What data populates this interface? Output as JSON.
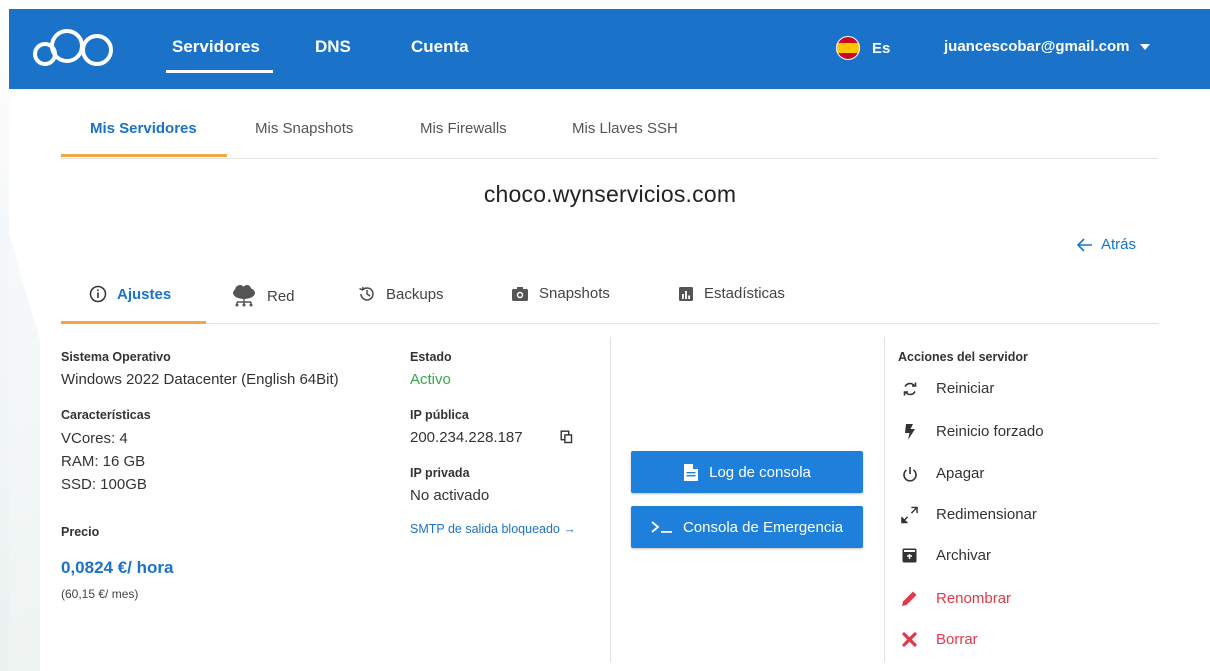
{
  "brand": {
    "logo_icon": "cloud-circles-logo",
    "accent": "#1a73c9",
    "highlight": "#f5a640"
  },
  "topnav": {
    "items": [
      "Servidores",
      "DNS",
      "Cuenta"
    ],
    "active": "Servidores",
    "language": "Es",
    "user_email": "juancescobar@gmail.com"
  },
  "subtabs": {
    "items": [
      "Mis Servidores",
      "Mis Snapshots",
      "Mis Firewalls",
      "Mis Llaves SSH"
    ],
    "active": "Mis Servidores"
  },
  "server": {
    "hostname": "choco.wynservicios.com",
    "back_label": "Atrás"
  },
  "detail_tabs": {
    "items": [
      "Ajustes",
      "Red",
      "Backups",
      "Snapshots",
      "Estadísticas"
    ],
    "active": "Ajustes"
  },
  "settings": {
    "os_label": "Sistema Operativo",
    "os_value": "Windows 2022 Datacenter (English 64Bit)",
    "features_label": "Características",
    "vcores": "VCores: 4",
    "ram": "RAM: 16 GB",
    "ssd": "SSD: 100GB",
    "price_label": "Precio",
    "price_hour": "0,0824 €/ hora",
    "price_month": "(60,15 €/ mes)",
    "state_label": "Estado",
    "state_value": "Activo",
    "public_ip_label": "IP pública",
    "public_ip_value": "200.234.228.187",
    "private_ip_label": "IP privada",
    "private_ip_value": "No activado",
    "smtp_link": "SMTP de salida bloqueado →"
  },
  "buttons": {
    "console_log": "Log de consola",
    "emergency_console": "Consola de Emergencia"
  },
  "actions": {
    "title": "Acciones del servidor",
    "items": [
      "Reiniciar",
      "Reinicio forzado",
      "Apagar",
      "Redimensionar",
      "Archivar",
      "Renombrar",
      "Borrar"
    ],
    "danger_color": "#e0394a"
  }
}
